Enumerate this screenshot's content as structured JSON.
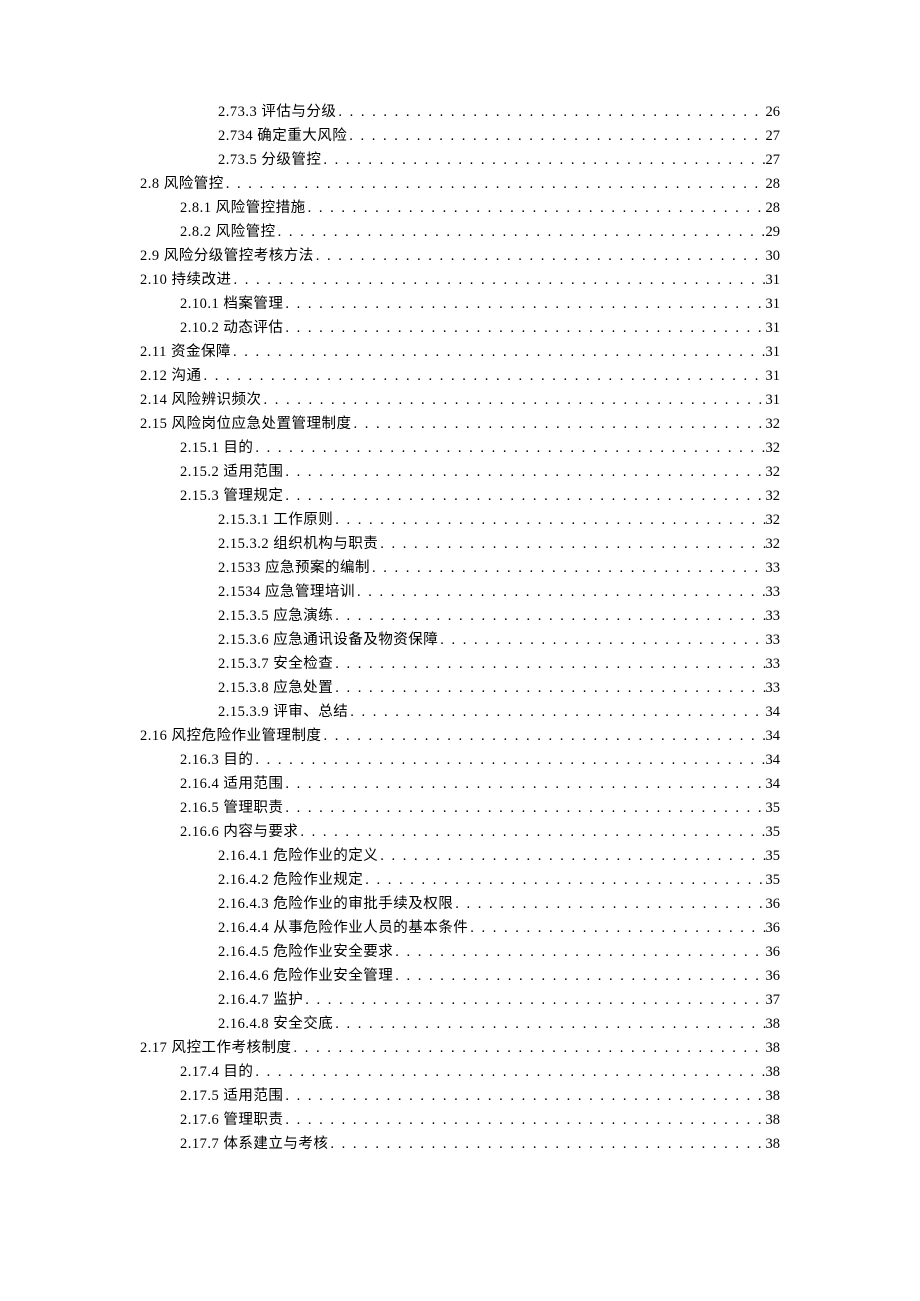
{
  "toc": [
    {
      "indent": 2,
      "num": "2.73.3",
      "title": "评估与分级",
      "page": "26"
    },
    {
      "indent": 2,
      "num": "2.734",
      "title": "确定重大风险",
      "page": "27",
      "nospace": true
    },
    {
      "indent": 2,
      "num": "2.73.5",
      "title": "分级管控",
      "page": "27",
      "nospace": true
    },
    {
      "indent": 0,
      "num": "2.8",
      "title": "风险管控",
      "page": "28"
    },
    {
      "indent": 1,
      "num": "2.8.1",
      "title": "风险管控措施",
      "page": "28"
    },
    {
      "indent": 1,
      "num": "2.8.2",
      "title": "风险管控",
      "page": "29"
    },
    {
      "indent": 0,
      "num": "2.9",
      "title": "风险分级管控考核方法",
      "page": "30"
    },
    {
      "indent": 0,
      "num": "2.10",
      "title": "持续改进",
      "page": "31"
    },
    {
      "indent": 1,
      "num": "2.10.1",
      "title": "档案管理",
      "page": "31"
    },
    {
      "indent": 1,
      "num": "2.10.2",
      "title": "动态评估",
      "page": "31"
    },
    {
      "indent": 0,
      "num": "2.11",
      "title": "资金保障",
      "page": "31"
    },
    {
      "indent": 0,
      "num": "2.12",
      "title": "沟通",
      "page": "31"
    },
    {
      "indent": 0,
      "num": "2.14",
      "title": "风险辨识频次",
      "page": "31"
    },
    {
      "indent": 0,
      "num": "2.15",
      "title": "风险岗位应急处置管理制度",
      "page": "32"
    },
    {
      "indent": 1,
      "num": "2.15.1",
      "title": "目的",
      "page": "32"
    },
    {
      "indent": 1,
      "num": "2.15.2",
      "title": "适用范围",
      "page": "32"
    },
    {
      "indent": 1,
      "num": "2.15.3",
      "title": "管理规定",
      "page": "32"
    },
    {
      "indent": 2,
      "num": "2.15.3.1",
      "title": "工作原则",
      "page": "32"
    },
    {
      "indent": 2,
      "num": "2.15.3.2",
      "title": "组织机构与职责",
      "page": "32"
    },
    {
      "indent": 2,
      "num": "2.1533",
      "title": "应急预案的编制",
      "page": "33",
      "nospace": true
    },
    {
      "indent": 2,
      "num": "2.1534",
      "title": "应急管理培训",
      "page": "33",
      "nospace": true
    },
    {
      "indent": 2,
      "num": "2.15.3.5",
      "title": "应急演练",
      "page": "33"
    },
    {
      "indent": 2,
      "num": "2.15.3.6",
      "title": "应急通讯设备及物资保障",
      "page": "33"
    },
    {
      "indent": 2,
      "num": "2.15.3.7",
      "title": "安全检查",
      "page": "33"
    },
    {
      "indent": 2,
      "num": "2.15.3.8",
      "title": "应急处置",
      "page": "33"
    },
    {
      "indent": 2,
      "num": "2.15.3.9",
      "title": "评审、总结",
      "page": "34"
    },
    {
      "indent": 0,
      "num": "2.16",
      "title": "风控危险作业管理制度",
      "page": "34"
    },
    {
      "indent": 1,
      "num": "2.16.3",
      "title": "目的",
      "page": "34"
    },
    {
      "indent": 1,
      "num": "2.16.4",
      "title": "适用范围",
      "page": "34"
    },
    {
      "indent": 1,
      "num": "2.16.5",
      "title": "管理职责",
      "page": "35"
    },
    {
      "indent": 1,
      "num": "2.16.6",
      "title": "内容与要求",
      "page": "35"
    },
    {
      "indent": 2,
      "num": "2.16.4.1",
      "title": "危险作业的定义",
      "page": "35"
    },
    {
      "indent": 2,
      "num": "2.16.4.2",
      "title": "危险作业规定",
      "page": "35"
    },
    {
      "indent": 2,
      "num": "2.16.4.3",
      "title": "危险作业的审批手续及权限",
      "page": "36"
    },
    {
      "indent": 2,
      "num": "2.16.4.4",
      "title": "从事危险作业人员的基本条件",
      "page": "36"
    },
    {
      "indent": 2,
      "num": "2.16.4.5",
      "title": "危险作业安全要求",
      "page": "36"
    },
    {
      "indent": 2,
      "num": "2.16.4.6",
      "title": "危险作业安全管理",
      "page": "36"
    },
    {
      "indent": 2,
      "num": "2.16.4.7",
      "title": "监护",
      "page": "37"
    },
    {
      "indent": 2,
      "num": "2.16.4.8",
      "title": "安全交底",
      "page": "38"
    },
    {
      "indent": 0,
      "num": "2.17",
      "title": "风控工作考核制度",
      "page": "38"
    },
    {
      "indent": 1,
      "num": "2.17.4",
      "title": "目的",
      "page": "38"
    },
    {
      "indent": 1,
      "num": "2.17.5",
      "title": "适用范围",
      "page": "38"
    },
    {
      "indent": 1,
      "num": "2.17.6",
      "title": "管理职责",
      "page": "38"
    },
    {
      "indent": 1,
      "num": "2.17.7",
      "title": "体系建立与考核",
      "page": "38"
    }
  ]
}
